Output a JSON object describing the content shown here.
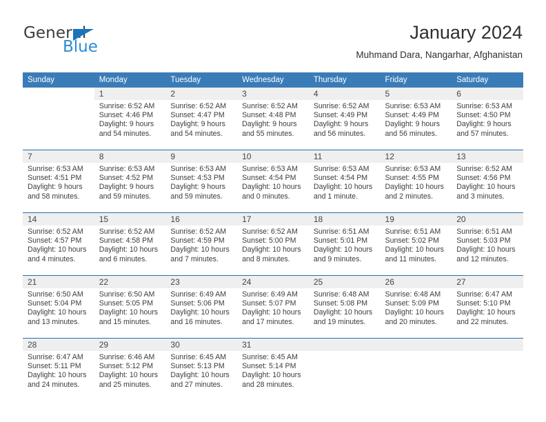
{
  "brand": {
    "name_top": "General",
    "name_bottom": "Blue",
    "triangle_color": "#1b74bb",
    "blue_text_color": "#2b8cd4"
  },
  "header": {
    "title": "January 2024",
    "subtitle": "Muhmand Dara, Nangarhar, Afghanistan",
    "header_bg": "#3a7cb8",
    "row_divider": "#2a6ca8",
    "daynum_bg": "#efefef"
  },
  "weekdays": [
    "Sunday",
    "Monday",
    "Tuesday",
    "Wednesday",
    "Thursday",
    "Friday",
    "Saturday"
  ],
  "weeks": [
    [
      {
        "day": "",
        "sunrise": "",
        "sunset": "",
        "daylight": "",
        "blank": true
      },
      {
        "day": "1",
        "sunrise": "Sunrise: 6:52 AM",
        "sunset": "Sunset: 4:46 PM",
        "daylight": "Daylight: 9 hours and 54 minutes."
      },
      {
        "day": "2",
        "sunrise": "Sunrise: 6:52 AM",
        "sunset": "Sunset: 4:47 PM",
        "daylight": "Daylight: 9 hours and 54 minutes."
      },
      {
        "day": "3",
        "sunrise": "Sunrise: 6:52 AM",
        "sunset": "Sunset: 4:48 PM",
        "daylight": "Daylight: 9 hours and 55 minutes."
      },
      {
        "day": "4",
        "sunrise": "Sunrise: 6:52 AM",
        "sunset": "Sunset: 4:49 PM",
        "daylight": "Daylight: 9 hours and 56 minutes."
      },
      {
        "day": "5",
        "sunrise": "Sunrise: 6:53 AM",
        "sunset": "Sunset: 4:49 PM",
        "daylight": "Daylight: 9 hours and 56 minutes."
      },
      {
        "day": "6",
        "sunrise": "Sunrise: 6:53 AM",
        "sunset": "Sunset: 4:50 PM",
        "daylight": "Daylight: 9 hours and 57 minutes."
      }
    ],
    [
      {
        "day": "7",
        "sunrise": "Sunrise: 6:53 AM",
        "sunset": "Sunset: 4:51 PM",
        "daylight": "Daylight: 9 hours and 58 minutes."
      },
      {
        "day": "8",
        "sunrise": "Sunrise: 6:53 AM",
        "sunset": "Sunset: 4:52 PM",
        "daylight": "Daylight: 9 hours and 59 minutes."
      },
      {
        "day": "9",
        "sunrise": "Sunrise: 6:53 AM",
        "sunset": "Sunset: 4:53 PM",
        "daylight": "Daylight: 9 hours and 59 minutes."
      },
      {
        "day": "10",
        "sunrise": "Sunrise: 6:53 AM",
        "sunset": "Sunset: 4:54 PM",
        "daylight": "Daylight: 10 hours and 0 minutes."
      },
      {
        "day": "11",
        "sunrise": "Sunrise: 6:53 AM",
        "sunset": "Sunset: 4:54 PM",
        "daylight": "Daylight: 10 hours and 1 minute."
      },
      {
        "day": "12",
        "sunrise": "Sunrise: 6:53 AM",
        "sunset": "Sunset: 4:55 PM",
        "daylight": "Daylight: 10 hours and 2 minutes."
      },
      {
        "day": "13",
        "sunrise": "Sunrise: 6:52 AM",
        "sunset": "Sunset: 4:56 PM",
        "daylight": "Daylight: 10 hours and 3 minutes."
      }
    ],
    [
      {
        "day": "14",
        "sunrise": "Sunrise: 6:52 AM",
        "sunset": "Sunset: 4:57 PM",
        "daylight": "Daylight: 10 hours and 4 minutes."
      },
      {
        "day": "15",
        "sunrise": "Sunrise: 6:52 AM",
        "sunset": "Sunset: 4:58 PM",
        "daylight": "Daylight: 10 hours and 6 minutes."
      },
      {
        "day": "16",
        "sunrise": "Sunrise: 6:52 AM",
        "sunset": "Sunset: 4:59 PM",
        "daylight": "Daylight: 10 hours and 7 minutes."
      },
      {
        "day": "17",
        "sunrise": "Sunrise: 6:52 AM",
        "sunset": "Sunset: 5:00 PM",
        "daylight": "Daylight: 10 hours and 8 minutes."
      },
      {
        "day": "18",
        "sunrise": "Sunrise: 6:51 AM",
        "sunset": "Sunset: 5:01 PM",
        "daylight": "Daylight: 10 hours and 9 minutes."
      },
      {
        "day": "19",
        "sunrise": "Sunrise: 6:51 AM",
        "sunset": "Sunset: 5:02 PM",
        "daylight": "Daylight: 10 hours and 11 minutes."
      },
      {
        "day": "20",
        "sunrise": "Sunrise: 6:51 AM",
        "sunset": "Sunset: 5:03 PM",
        "daylight": "Daylight: 10 hours and 12 minutes."
      }
    ],
    [
      {
        "day": "21",
        "sunrise": "Sunrise: 6:50 AM",
        "sunset": "Sunset: 5:04 PM",
        "daylight": "Daylight: 10 hours and 13 minutes."
      },
      {
        "day": "22",
        "sunrise": "Sunrise: 6:50 AM",
        "sunset": "Sunset: 5:05 PM",
        "daylight": "Daylight: 10 hours and 15 minutes."
      },
      {
        "day": "23",
        "sunrise": "Sunrise: 6:49 AM",
        "sunset": "Sunset: 5:06 PM",
        "daylight": "Daylight: 10 hours and 16 minutes."
      },
      {
        "day": "24",
        "sunrise": "Sunrise: 6:49 AM",
        "sunset": "Sunset: 5:07 PM",
        "daylight": "Daylight: 10 hours and 17 minutes."
      },
      {
        "day": "25",
        "sunrise": "Sunrise: 6:48 AM",
        "sunset": "Sunset: 5:08 PM",
        "daylight": "Daylight: 10 hours and 19 minutes."
      },
      {
        "day": "26",
        "sunrise": "Sunrise: 6:48 AM",
        "sunset": "Sunset: 5:09 PM",
        "daylight": "Daylight: 10 hours and 20 minutes."
      },
      {
        "day": "27",
        "sunrise": "Sunrise: 6:47 AM",
        "sunset": "Sunset: 5:10 PM",
        "daylight": "Daylight: 10 hours and 22 minutes."
      }
    ],
    [
      {
        "day": "28",
        "sunrise": "Sunrise: 6:47 AM",
        "sunset": "Sunset: 5:11 PM",
        "daylight": "Daylight: 10 hours and 24 minutes."
      },
      {
        "day": "29",
        "sunrise": "Sunrise: 6:46 AM",
        "sunset": "Sunset: 5:12 PM",
        "daylight": "Daylight: 10 hours and 25 minutes."
      },
      {
        "day": "30",
        "sunrise": "Sunrise: 6:45 AM",
        "sunset": "Sunset: 5:13 PM",
        "daylight": "Daylight: 10 hours and 27 minutes."
      },
      {
        "day": "31",
        "sunrise": "Sunrise: 6:45 AM",
        "sunset": "Sunset: 5:14 PM",
        "daylight": "Daylight: 10 hours and 28 minutes."
      },
      {
        "day": "",
        "sunrise": "",
        "sunset": "",
        "daylight": "",
        "empty": true
      },
      {
        "day": "",
        "sunrise": "",
        "sunset": "",
        "daylight": "",
        "empty": true
      },
      {
        "day": "",
        "sunrise": "",
        "sunset": "",
        "daylight": "",
        "empty": true
      }
    ]
  ]
}
